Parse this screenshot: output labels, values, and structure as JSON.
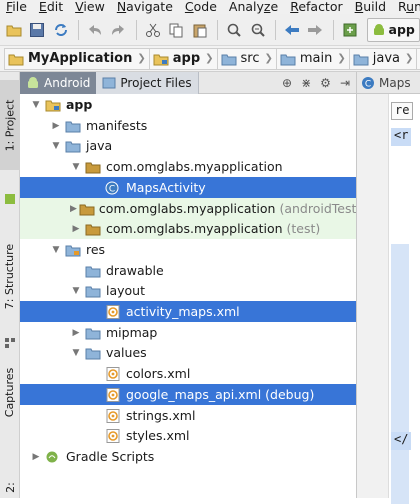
{
  "menu": [
    {
      "pre": "",
      "u": "F",
      "post": "ile"
    },
    {
      "pre": "",
      "u": "E",
      "post": "dit"
    },
    {
      "pre": "",
      "u": "V",
      "post": "iew"
    },
    {
      "pre": "",
      "u": "N",
      "post": "avigate"
    },
    {
      "pre": "",
      "u": "C",
      "post": "ode"
    },
    {
      "pre": "Analy",
      "u": "z",
      "post": "e"
    },
    {
      "pre": "",
      "u": "R",
      "post": "efactor"
    },
    {
      "pre": "",
      "u": "B",
      "post": "uild"
    },
    {
      "pre": "R",
      "u": "u",
      "post": "n"
    },
    {
      "pre": "",
      "u": "T",
      "post": "oo"
    }
  ],
  "toolbar": {
    "run_config": "app",
    "icons": [
      "open-icon",
      "save-icon",
      "sync-icon",
      "undo-icon",
      "redo-icon",
      "cut-icon",
      "copy-icon",
      "paste-icon",
      "find-icon",
      "replace-icon",
      "back-icon",
      "forward-icon",
      "make-icon"
    ]
  },
  "breadcrumb": [
    "MyApplication",
    "app",
    "src",
    "main",
    "java",
    "com"
  ],
  "vertical_tabs": {
    "project": "1: Project",
    "structure": "7: Structure",
    "captures": "Captures",
    "favorites": "2:"
  },
  "pane": {
    "tab_android": "Android",
    "tab_project_files": "Project Files",
    "tools": [
      "target-icon",
      "split-icon",
      "gear-icon",
      "hide-icon"
    ]
  },
  "tree": [
    {
      "label": "app",
      "bold": true,
      "depth": 0,
      "twisty": "open",
      "icon": "module-folder-icon",
      "state": "normal"
    },
    {
      "label": "manifests",
      "depth": 1,
      "twisty": "closed",
      "icon": "folder-icon",
      "state": "normal"
    },
    {
      "label": "java",
      "depth": 1,
      "twisty": "open",
      "icon": "folder-icon",
      "state": "normal"
    },
    {
      "label": "com.omglabs.myapplication",
      "depth": 2,
      "twisty": "open",
      "icon": "package-icon",
      "state": "normal"
    },
    {
      "label": "MapsActivity",
      "depth": 3,
      "twisty": "none",
      "icon": "class-icon",
      "state": "selected"
    },
    {
      "label": "com.omglabs.myapplication",
      "suffix": "(androidTest)",
      "depth": 2,
      "twisty": "closed",
      "icon": "package-icon",
      "state": "test"
    },
    {
      "label": "com.omglabs.myapplication",
      "suffix": "(test)",
      "depth": 2,
      "twisty": "closed",
      "icon": "package-icon",
      "state": "test"
    },
    {
      "label": "res",
      "depth": 1,
      "twisty": "open",
      "icon": "res-folder-icon",
      "state": "normal"
    },
    {
      "label": "drawable",
      "depth": 2,
      "twisty": "none",
      "icon": "folder-icon",
      "state": "normal"
    },
    {
      "label": "layout",
      "depth": 2,
      "twisty": "open",
      "icon": "folder-icon",
      "state": "normal"
    },
    {
      "label": "activity_maps.xml",
      "depth": 3,
      "twisty": "none",
      "icon": "xml-file-icon",
      "state": "selected"
    },
    {
      "label": "mipmap",
      "depth": 2,
      "twisty": "closed",
      "icon": "folder-icon",
      "state": "normal"
    },
    {
      "label": "values",
      "depth": 2,
      "twisty": "open",
      "icon": "folder-icon",
      "state": "normal"
    },
    {
      "label": "colors.xml",
      "depth": 3,
      "twisty": "none",
      "icon": "xml-file-icon",
      "state": "normal"
    },
    {
      "label": "google_maps_api.xml (debug)",
      "depth": 3,
      "twisty": "none",
      "icon": "xml-file-icon",
      "state": "selected"
    },
    {
      "label": "strings.xml",
      "depth": 3,
      "twisty": "none",
      "icon": "xml-file-icon",
      "state": "normal"
    },
    {
      "label": "styles.xml",
      "depth": 3,
      "twisty": "none",
      "icon": "xml-file-icon",
      "state": "normal"
    },
    {
      "label": "Gradle Scripts",
      "depth": 0,
      "twisty": "closed",
      "icon": "gradle-icon",
      "state": "normal"
    }
  ],
  "editor": {
    "tab_label": "Maps",
    "snippet": "re",
    "line": "<r",
    "end": "</"
  },
  "colors": {
    "selection": "#3875d7",
    "test_row": "#e9f7e6",
    "folder": "#8fb4d9",
    "xml_icon": "#e69a2a"
  }
}
